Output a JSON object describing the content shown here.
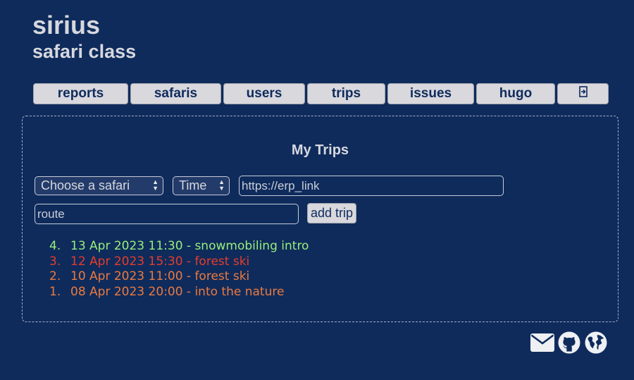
{
  "brand": {
    "title": "sirius",
    "subtitle": "safari class"
  },
  "nav": {
    "items": [
      {
        "label": "reports"
      },
      {
        "label": "safaris"
      },
      {
        "label": "users"
      },
      {
        "label": "trips"
      },
      {
        "label": "issues"
      },
      {
        "label": "hugo"
      }
    ],
    "logout_icon": "logout-icon"
  },
  "main": {
    "title": "My Trips",
    "form": {
      "safari_select": {
        "selected": "Choose a safari"
      },
      "time_select": {
        "selected": "Time"
      },
      "erp_link": {
        "placeholder": "https://erp_link",
        "value": ""
      },
      "route": {
        "placeholder": "route",
        "value": ""
      },
      "add_label": "add trip"
    },
    "trips": [
      {
        "number": "4.",
        "text": "13 Apr 2023 11:30 - snowmobiling intro",
        "color": "#98ee7a"
      },
      {
        "number": "3.",
        "text": "12 Apr 2023 15:30 - forest ski",
        "color": "#e63c2a"
      },
      {
        "number": "2.",
        "text": "10 Apr 2023 11:00 - forest ski",
        "color": "#ec7a3e"
      },
      {
        "number": "1.",
        "text": "08 Apr 2023 20:00 - into the nature",
        "color": "#ec7a3e"
      }
    ]
  },
  "footer": {
    "icons": [
      "mail-icon",
      "github-icon",
      "globe-icon"
    ]
  }
}
